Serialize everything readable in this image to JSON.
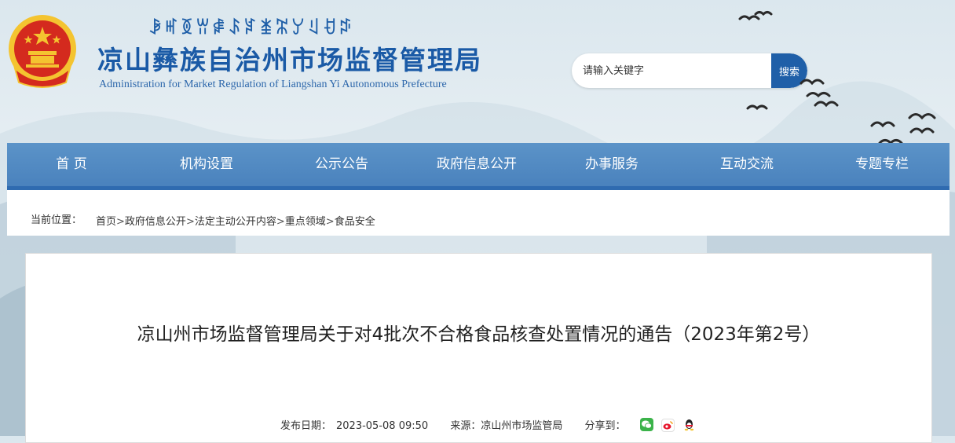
{
  "header": {
    "yi_script": "ꆃꎭꅉꀕꍂꌺꋇꁧꄓꌦꆹꀀꁯ",
    "title": "凉山彝族自治州市场监督管理局",
    "subtitle": "Administration for Market Regulation of Liangshan Yi Autonomous Prefecture"
  },
  "search": {
    "placeholder": "请输入关键字",
    "button_label": "搜索"
  },
  "nav": {
    "items": [
      {
        "label": "首 页"
      },
      {
        "label": "机构设置"
      },
      {
        "label": "公示公告"
      },
      {
        "label": "政府信息公开"
      },
      {
        "label": "办事服务"
      },
      {
        "label": "互动交流"
      },
      {
        "label": "专题专栏"
      }
    ]
  },
  "breadcrumb": {
    "label": "当前位置：",
    "items": [
      "首页",
      "政府信息公开",
      "法定主动公开内容",
      "重点领域",
      "食品安全"
    ],
    "separator": ">"
  },
  "article": {
    "title": "凉山州市场监督管理局关于对4批次不合格食品核查处置情况的通告（2023年第2号）",
    "publish_label": "发布日期：",
    "publish_date": "2023-05-08 09:50",
    "source_label": "来源：",
    "source": "凉山州市场监管局",
    "share_label": "分享到："
  },
  "icons": {
    "emblem": "national-emblem-icon",
    "wechat": "wechat-icon",
    "weibo": "weibo-icon",
    "qq": "qq-icon"
  },
  "colors": {
    "brand_blue": "#1f5fa8",
    "nav_blue": "#4a82bd",
    "emblem_red": "#d42a1e",
    "emblem_gold": "#f4c430"
  }
}
